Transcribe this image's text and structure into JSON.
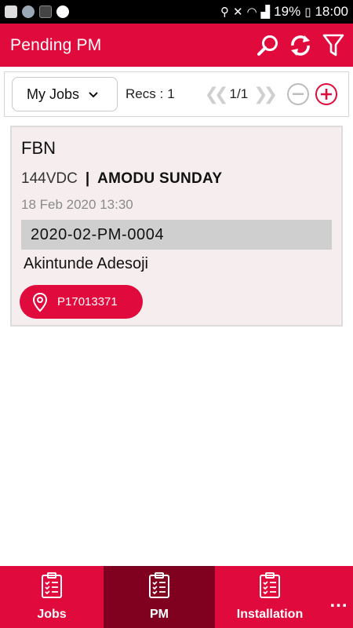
{
  "status_bar": {
    "battery_text": "19%",
    "time": "18:00"
  },
  "app_bar": {
    "title": "Pending PM",
    "icons": [
      "search-icon",
      "refresh-icon",
      "filter-icon"
    ]
  },
  "toolbar": {
    "filter_selected": "My Jobs",
    "recs_label": "Recs :",
    "recs_count": "1",
    "page_indicator": "1/1"
  },
  "job_card": {
    "title": "FBN",
    "voltage": "144VDC",
    "separator": "|",
    "engineer": "AMODU SUNDAY",
    "date": "18 Feb 2020 13:30",
    "reference": "2020-02-PM-0004",
    "person": "Akintunde Adesoji",
    "site_id": "P17013371"
  },
  "bottom_nav": {
    "items": [
      {
        "label": "Jobs",
        "icon": "clipboard-icon"
      },
      {
        "label": "PM",
        "icon": "clipboard-icon"
      },
      {
        "label": "Installation",
        "icon": "clipboard-icon"
      }
    ],
    "more": "..."
  },
  "colors": {
    "brand": "#e10a3c",
    "active_tab": "#800020",
    "card_bg": "#f6eeee"
  }
}
